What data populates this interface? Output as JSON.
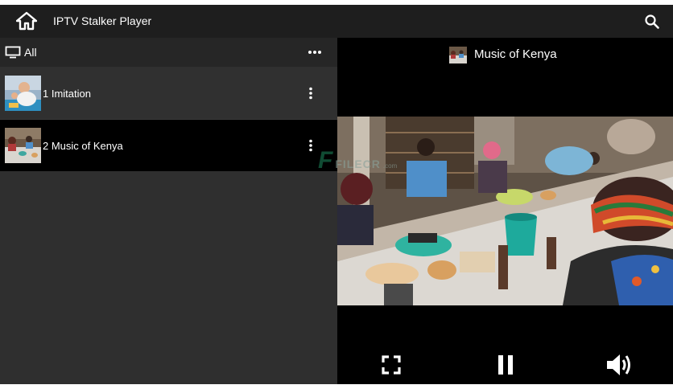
{
  "app": {
    "title": "IPTV Stalker Player"
  },
  "icons": {
    "home": "home-icon",
    "search": "search-icon",
    "tv": "tv-icon",
    "more_horizontal": "more-horizontal-icon",
    "more_vertical": "more-vertical-icon",
    "fullscreen": "fullscreen-icon",
    "pause": "pause-icon",
    "volume": "volume-icon"
  },
  "filter": {
    "label": "All"
  },
  "channels": [
    {
      "label": "1 Imitation"
    },
    {
      "label": "2 Music of Kenya"
    }
  ],
  "player": {
    "now_playing": "Music of Kenya"
  },
  "watermark": {
    "mark": "F",
    "text": "FILECR",
    "suffix": ".com"
  }
}
